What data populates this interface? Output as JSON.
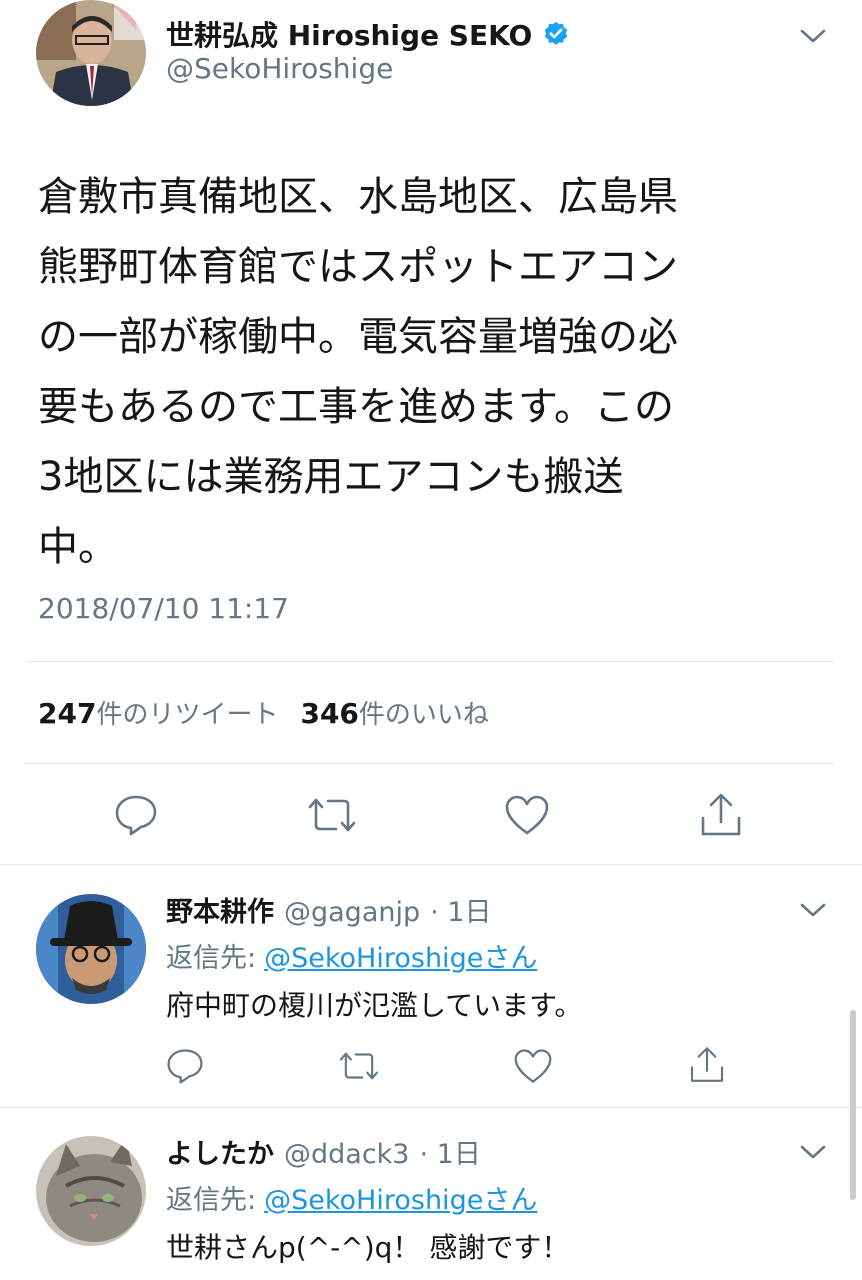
{
  "main_tweet": {
    "display_name": "世耕弘成 Hiroshige SEKO",
    "handle": "@SekoHiroshige",
    "text": "倉敷市真備地区、水島地区、広島県\n熊野町体育館ではスポットエアコン\nの一部が稼働中。電気容量増強の必\n要もあるので工事を進めます。この\n3地区には業務用エアコンも搬送\n中。",
    "timestamp": "2018/07/10 11:17",
    "retweet_count": "247",
    "retweet_label": "件のリツイート",
    "like_count": "346",
    "like_label": "件のいいね",
    "icons": [
      "verified-badge-icon",
      "chevron-down-icon",
      "reply-icon",
      "retweet-icon",
      "like-icon",
      "share-icon"
    ]
  },
  "replies": [
    {
      "display_name": "野本耕作",
      "handle": "@gaganjp",
      "time": "· 1日",
      "reply_to_label": "返信先:",
      "reply_to_user": "@SekoHiroshigeさん",
      "text": "府中町の榎川が氾濫しています。"
    },
    {
      "display_name": "よしたか",
      "handle": "@ddack3",
      "time": "· 1日",
      "reply_to_label": "返信先:",
      "reply_to_user": "@SekoHiroshigeさん",
      "text": "世耕さんp(^-^)q！ 感謝です！"
    }
  ],
  "colors": {
    "text": "#14171a",
    "secondary": "#657786",
    "link": "#1b95e0",
    "verified": "#1da1f2",
    "divider": "#e1e8ed"
  }
}
